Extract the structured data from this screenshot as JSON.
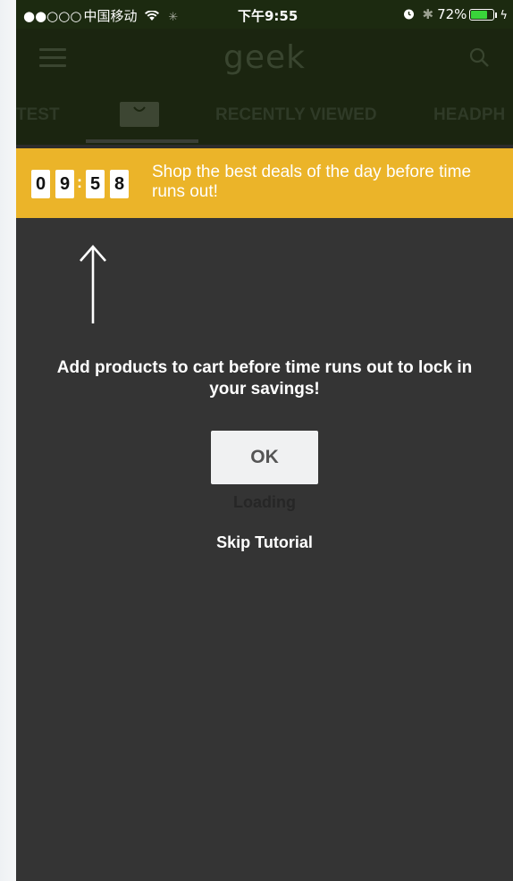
{
  "status_bar": {
    "signal": "●●○○○",
    "carrier": "中国移动",
    "wifi": "wifi-icon",
    "time": "下午9:55",
    "battery_percent": "72%",
    "battery_level": 0.72,
    "charging_color": "#39d43a"
  },
  "header": {
    "logo": "geek"
  },
  "tabs": {
    "items": [
      {
        "label": "TEST"
      },
      {
        "label": ""
      },
      {
        "label": "RECENTLY VIEWED"
      },
      {
        "label": "HEADPH"
      }
    ],
    "selected_index": 1
  },
  "deal_banner": {
    "countdown": [
      "0",
      "9",
      "5",
      "8"
    ],
    "separator": ":",
    "message": "Shop the best deals of the day before time runs out!",
    "color": "#ebb429"
  },
  "tutorial": {
    "message": "Add products to cart before time runs out to lock in your savings!",
    "ok_label": "OK",
    "loading_label": "Loading",
    "skip_label": "Skip Tutorial"
  }
}
